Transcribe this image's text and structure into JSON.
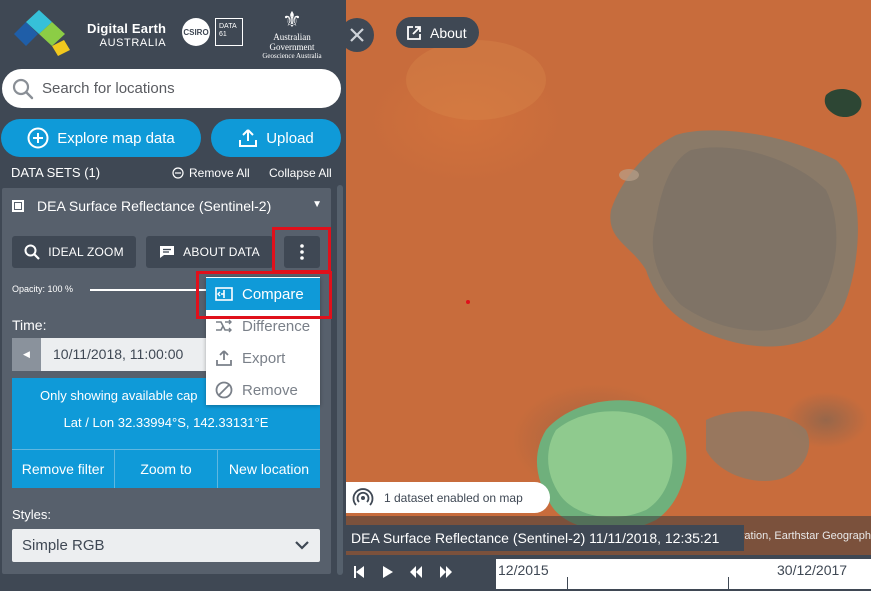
{
  "brand": {
    "title_line1": "Digital Earth",
    "title_line2": "AUSTRALIA",
    "partner1": "CSIRO",
    "partner2": "DATA 61",
    "gov_line1": "Australian Government",
    "gov_line2": "Geoscience Australia",
    "colors": [
      "#36c0d8",
      "#8ccd45",
      "#1f5ea8",
      "#f1c81e"
    ]
  },
  "search": {
    "placeholder": "Search for locations",
    "icon": "search-icon"
  },
  "actions": {
    "explore_label": "Explore map data",
    "upload_label": "Upload"
  },
  "datasets": {
    "header": "DATA SETS (1)",
    "remove_all": "Remove All",
    "collapse_all": "Collapse All"
  },
  "layer": {
    "title": "DEA Surface Reflectance (Sentinel-2)",
    "ideal_zoom": "IDEAL ZOOM",
    "about_data": "ABOUT DATA",
    "opacity_label": "Opacity: 100 %",
    "opacity_value": 1.0,
    "time_label": "Time:",
    "time_value": "10/11/2018, 11:00:00",
    "info_line1": "Only showing available cap",
    "info_line2": "Lat / Lon 32.33994°S, 142.33131°E",
    "filter_buttons": [
      "Remove filter",
      "Zoom to",
      "New location"
    ],
    "styles_label": "Styles:",
    "styles_value": "Simple RGB"
  },
  "menu": {
    "items": [
      {
        "label": "Compare",
        "icon": "compare-icon",
        "active": true
      },
      {
        "label": "Difference",
        "icon": "difference-icon",
        "active": false
      },
      {
        "label": "Export",
        "icon": "export-icon",
        "active": false
      },
      {
        "label": "Remove",
        "icon": "remove-icon",
        "active": false
      }
    ]
  },
  "map": {
    "about_label": "About",
    "datasets_enabled": "1 dataset enabled on map",
    "layer_time": "DEA Surface Reflectance (Sentinel-2) 11/11/2018, 12:35:21",
    "attribution": "ration, Earthstar Geograph"
  },
  "timeline": {
    "start": "12/2015",
    "end": "30/12/2017"
  },
  "colors": {
    "accent": "#0f9ad8",
    "panel": "#3f4854",
    "highlight": "#e0101b"
  }
}
